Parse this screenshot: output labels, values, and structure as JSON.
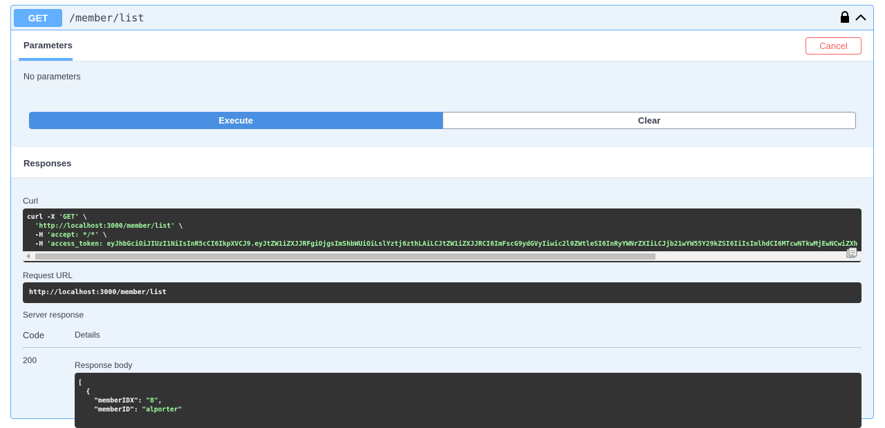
{
  "operation": {
    "method": "GET",
    "path": "/member/list"
  },
  "tabs": {
    "parameters": "Parameters",
    "cancel": "Cancel"
  },
  "parameters": {
    "empty_text": "No parameters"
  },
  "buttons": {
    "execute": "Execute",
    "clear": "Clear"
  },
  "responses": {
    "title": "Responses",
    "curl_label": "Curl",
    "curl_lines": {
      "l1": "curl -X ",
      "l1_method": "'GET'",
      "l1_end": " \\",
      "l2": "'http://localhost:3000/member/list'",
      "l2_end": " \\",
      "l3_flag": "  -H ",
      "l3": "'accept: */*'",
      "l3_end": " \\",
      "l4_flag": "  -H ",
      "l4": "'access_token: eyJhbGciOiJIUzI1NiIsInR5cCI6IkpXVCJ9.eyJtZW1iZXJJRFgiOjgsImShbWUiOiLslYztj6zthLAiLCJtZW1iZXJJRCI6ImFscG9ydGVyIiwic2l0ZWtleSI6InRyYWNrZXIiLCJjb21wYW55Y29kZSI6IiIsImlhdCI6MTcwNTkwMjEwNCwiZXh"
    },
    "request_url_label": "Request URL",
    "request_url": "http://localhost:3000/member/list",
    "server_response_label": "Server response",
    "col_code": "Code",
    "col_details": "Details",
    "status_code": "200",
    "response_body_label": "Response body",
    "body_lines": {
      "l1": "[",
      "l2": "  {",
      "l3_key": "    \"memberIDX\": ",
      "l3_val": "\"8\"",
      "l3_end": ",",
      "l4_key": "    \"memberID\": ",
      "l4_val": "\"alporter\""
    }
  },
  "icons": {
    "lock": "lock-icon",
    "collapse": "chevron-up-icon",
    "copy": "copy-icon"
  },
  "colors": {
    "get_method": "#61affe",
    "execute": "#4990e2",
    "cancel": "#ff6060",
    "code_bg": "#333333",
    "code_string": "#a2fca2"
  }
}
